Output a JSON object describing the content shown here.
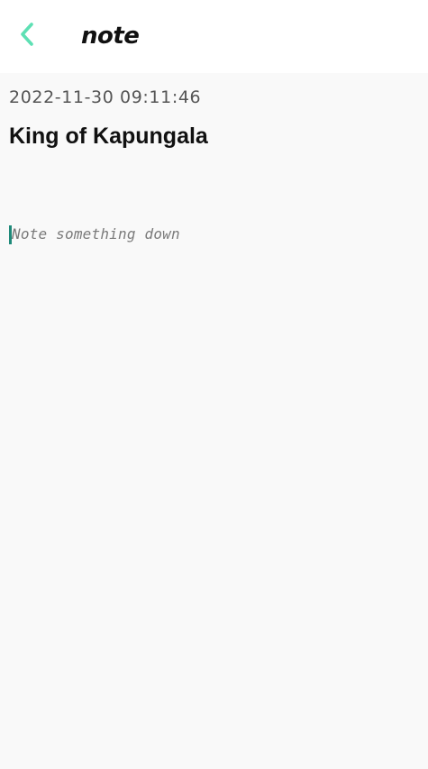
{
  "header": {
    "back_icon": "chevron-left-icon",
    "title": "note",
    "accent_color": "#5ee0b4"
  },
  "note": {
    "timestamp": "2022-11-30 09:11:46",
    "title": "King of Kapungala",
    "body_value": "",
    "body_placeholder": "Note something down"
  }
}
